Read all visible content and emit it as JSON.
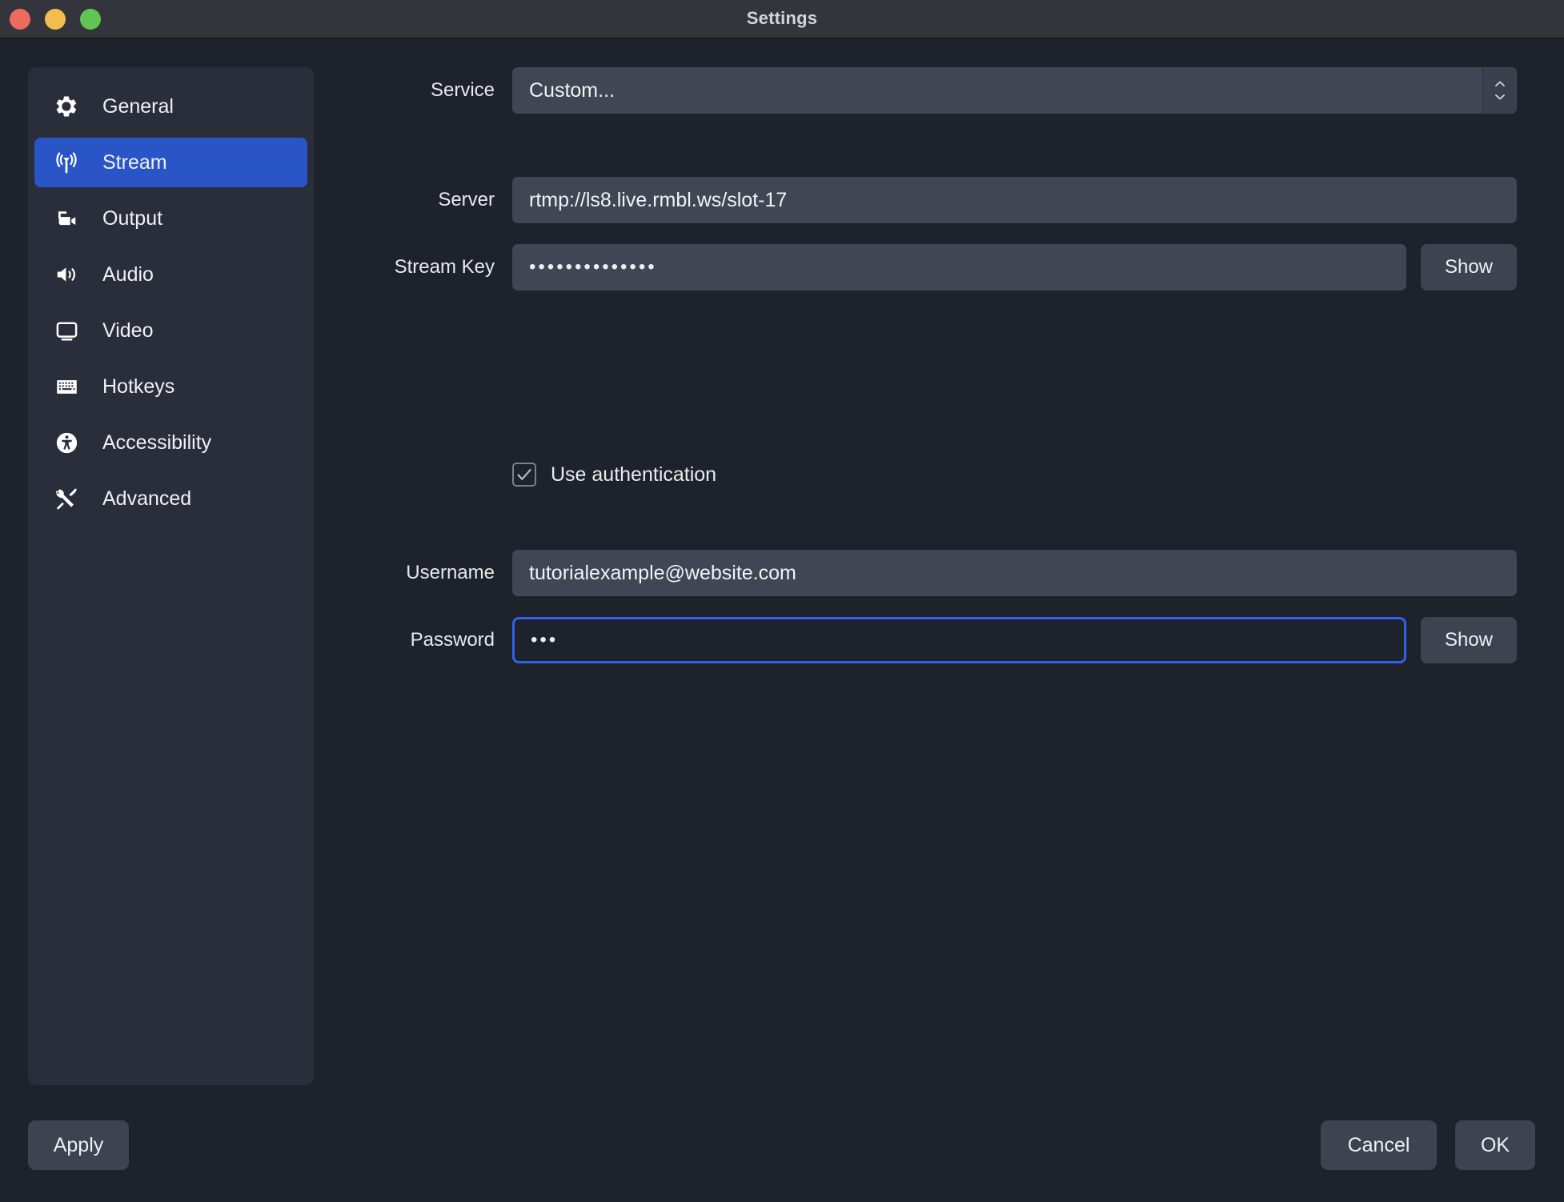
{
  "window": {
    "title": "Settings",
    "traffic_lights": [
      {
        "name": "close",
        "color": "#ed6a5e"
      },
      {
        "name": "minimize",
        "color": "#f4bd4f"
      },
      {
        "name": "zoom",
        "color": "#61c554"
      }
    ]
  },
  "sidebar": {
    "items": [
      {
        "label": "General",
        "icon": "gear-icon",
        "active": false
      },
      {
        "label": "Stream",
        "icon": "broadcast-icon",
        "active": true
      },
      {
        "label": "Output",
        "icon": "video-camera-icon",
        "active": false
      },
      {
        "label": "Audio",
        "icon": "speaker-icon",
        "active": false
      },
      {
        "label": "Video",
        "icon": "monitor-icon",
        "active": false
      },
      {
        "label": "Hotkeys",
        "icon": "keyboard-icon",
        "active": false
      },
      {
        "label": "Accessibility",
        "icon": "accessibility-icon",
        "active": false
      },
      {
        "label": "Advanced",
        "icon": "tools-icon",
        "active": false
      }
    ],
    "active_accent": "#2a55c7"
  },
  "stream_settings": {
    "service": {
      "label": "Service",
      "value": "Custom..."
    },
    "server": {
      "label": "Server",
      "value": "rtmp://ls8.live.rmbl.ws/slot-17"
    },
    "stream_key": {
      "label": "Stream Key",
      "value": "••••••••••••••",
      "show_button": "Show"
    },
    "use_authentication": {
      "label": "Use authentication",
      "checked": true
    },
    "username": {
      "label": "Username",
      "value": "tutorialexample@website.com"
    },
    "password": {
      "label": "Password",
      "value": "•••",
      "show_button": "Show",
      "focused": true,
      "focus_color": "#2f62e8"
    }
  },
  "footer": {
    "apply_label": "Apply",
    "cancel_label": "Cancel",
    "ok_label": "OK"
  }
}
